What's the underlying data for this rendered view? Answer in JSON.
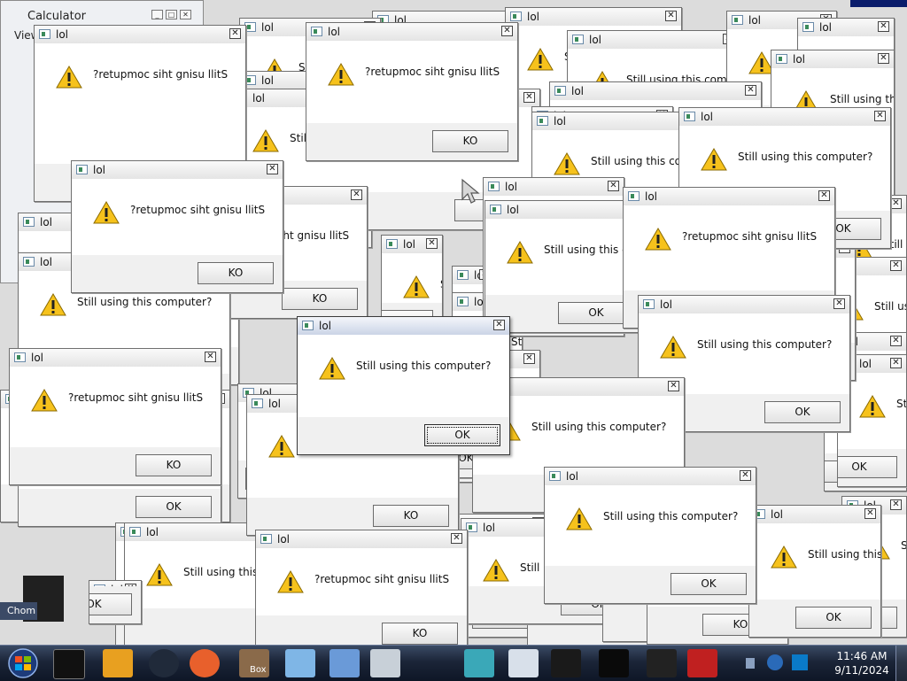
{
  "calculator": {
    "title": "Calculator",
    "menu_label": "View"
  },
  "dialog_title": "lol",
  "close_glyph": "✕",
  "messages": {
    "normal": "Still using this computer?",
    "reversed": "?retupmoc siht gnisu llitS"
  },
  "buttons": {
    "ok": "OK",
    "ko": "KO"
  },
  "taskbar": {
    "clock_time": "11:46 AM",
    "clock_date": "9/11/2024",
    "box_label": "Box",
    "chrome_label": "Chom"
  },
  "colors": {
    "taskbar": "#1b2538",
    "dialog_body": "#ffffff",
    "dialog_footer": "#f0f0f0",
    "warning_yellow": "#f6c21c"
  },
  "icons": {
    "warning": "warning-icon",
    "close": "close-icon",
    "start": "windows-start-icon"
  }
}
